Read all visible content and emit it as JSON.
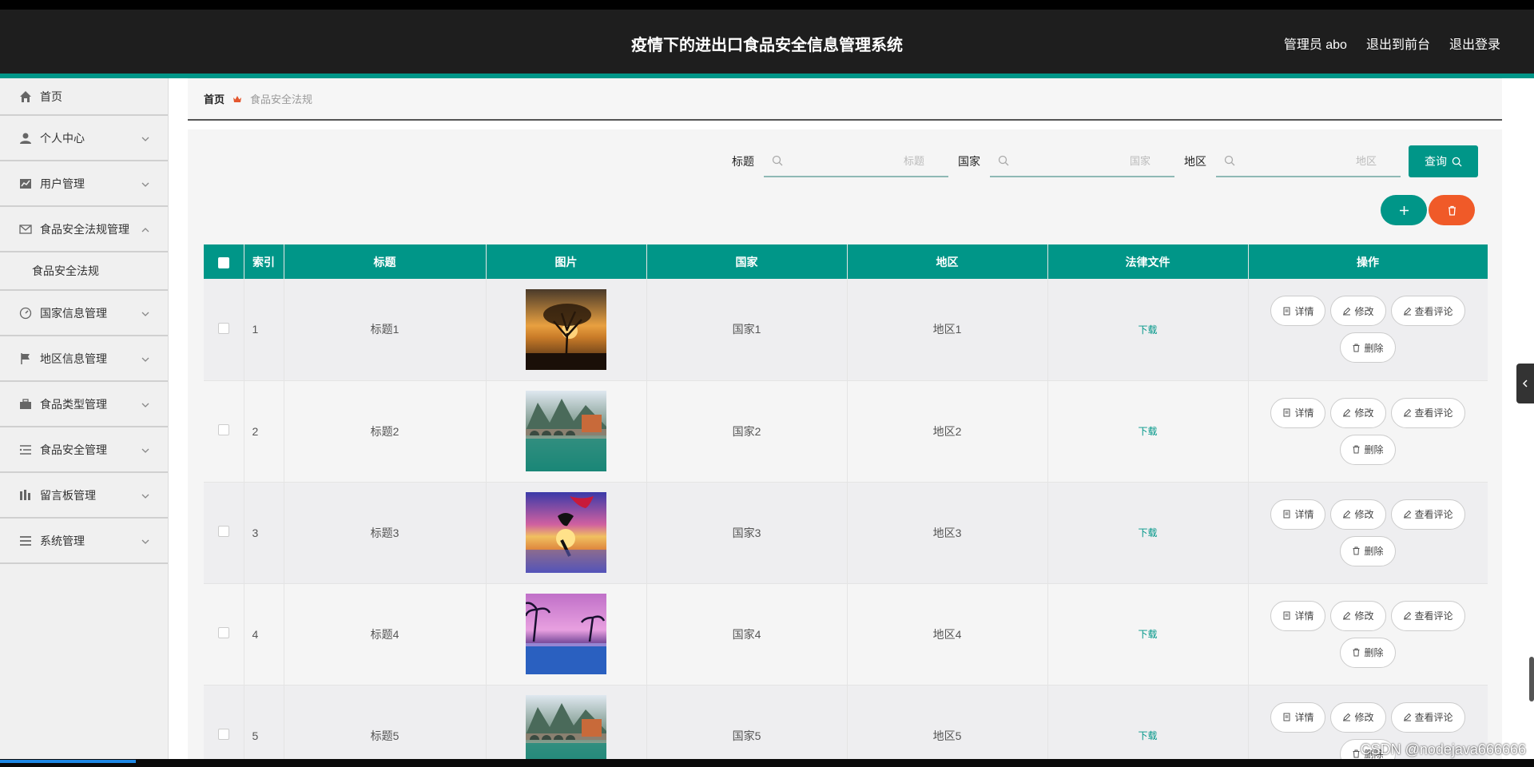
{
  "header": {
    "title": "疫情下的进出口食品安全信息管理系统",
    "admin_label": "管理员 abo",
    "back_front": "退出到前台",
    "logout": "退出登录"
  },
  "sidebar": {
    "items": [
      {
        "label": "首页",
        "icon": "home-icon"
      },
      {
        "label": "个人中心",
        "icon": "user-icon"
      },
      {
        "label": "用户管理",
        "icon": "chart-icon"
      },
      {
        "label": "食品安全法规管理",
        "icon": "mail-icon",
        "expanded": true
      },
      {
        "label": "国家信息管理",
        "icon": "dashboard-icon"
      },
      {
        "label": "地区信息管理",
        "icon": "flag-icon"
      },
      {
        "label": "食品类型管理",
        "icon": "briefcase-icon"
      },
      {
        "label": "食品安全管理",
        "icon": "list-icon"
      },
      {
        "label": "留言板管理",
        "icon": "bars-icon"
      },
      {
        "label": "系统管理",
        "icon": "menu-icon"
      }
    ],
    "sub_item": "食品安全法规"
  },
  "breadcrumb": {
    "home": "首页",
    "current": "食品安全法规"
  },
  "search": {
    "title_label": "标题",
    "title_placeholder": "标题",
    "country_label": "国家",
    "country_placeholder": "国家",
    "region_label": "地区",
    "region_placeholder": "地区",
    "query_button": "查询"
  },
  "table": {
    "headers": [
      "索引",
      "标题",
      "图片",
      "国家",
      "地区",
      "法律文件",
      "操作"
    ],
    "rows": [
      {
        "index": "1",
        "title": "标题1",
        "image": "tree-sunset",
        "country": "国家1",
        "region": "地区1",
        "file": "下载"
      },
      {
        "index": "2",
        "title": "标题2",
        "image": "mountain-bridge",
        "country": "国家2",
        "region": "地区2",
        "file": "下载"
      },
      {
        "index": "3",
        "title": "标题3",
        "image": "dolphin-sunset",
        "country": "国家3",
        "region": "地区3",
        "file": "下载"
      },
      {
        "index": "4",
        "title": "标题4",
        "image": "palm-pool",
        "country": "国家4",
        "region": "地区4",
        "file": "下载"
      },
      {
        "index": "5",
        "title": "标题5",
        "image": "mountain-bridge",
        "country": "国家5",
        "region": "地区5",
        "file": "下载"
      }
    ],
    "ops": {
      "detail": "详情",
      "edit": "修改",
      "comments": "查看评论",
      "delete": "删除"
    }
  },
  "watermark": "CSDN @nodejava666666",
  "colors": {
    "primary": "#009688",
    "danger": "#f05a28",
    "header_bg": "#1e1e1e"
  }
}
